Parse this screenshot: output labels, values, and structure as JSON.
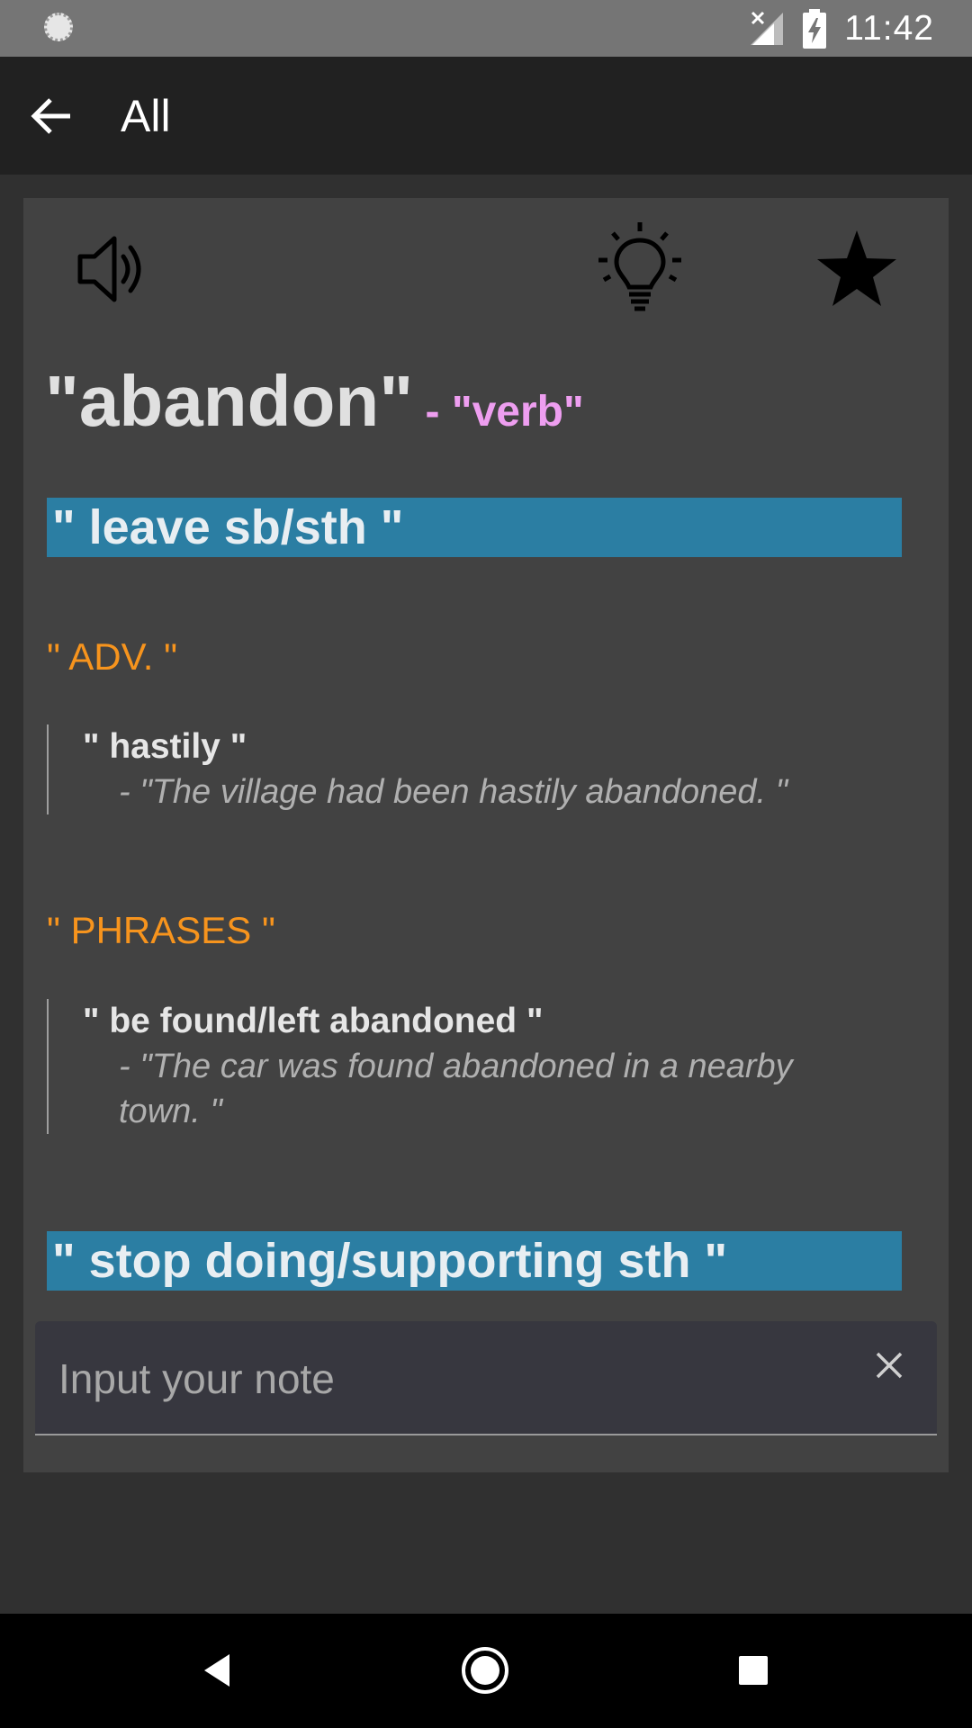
{
  "status_bar": {
    "time": "11:42"
  },
  "app_bar": {
    "title": "All"
  },
  "toolbar_icons": [
    "speaker-icon",
    "lightbulb-icon",
    "star-icon"
  ],
  "entry": {
    "word": "\"abandon\"",
    "part_of_speech": " - \"verb\"",
    "senses": [
      {
        "heading": "\" leave sb/sth \"",
        "groups": [
          {
            "label": "\" ADV. \"",
            "items": [
              {
                "collocation": "\" hastily \"",
                "example": "- \"The village had been hastily abandoned. \""
              }
            ]
          },
          {
            "label": "\" PHRASES \"",
            "items": [
              {
                "collocation": "\" be found/left abandoned \"",
                "example": "- \"The car was found abandoned in a nearby town. \""
              }
            ]
          }
        ]
      },
      {
        "heading": "\" stop doing/supporting sth \""
      }
    ]
  },
  "note": {
    "placeholder": "Input your note",
    "value": ""
  },
  "colors": {
    "sense_bar": "#2b7ea3",
    "section_label": "#f7941d",
    "part_of_speech": "#ee9ef0"
  }
}
